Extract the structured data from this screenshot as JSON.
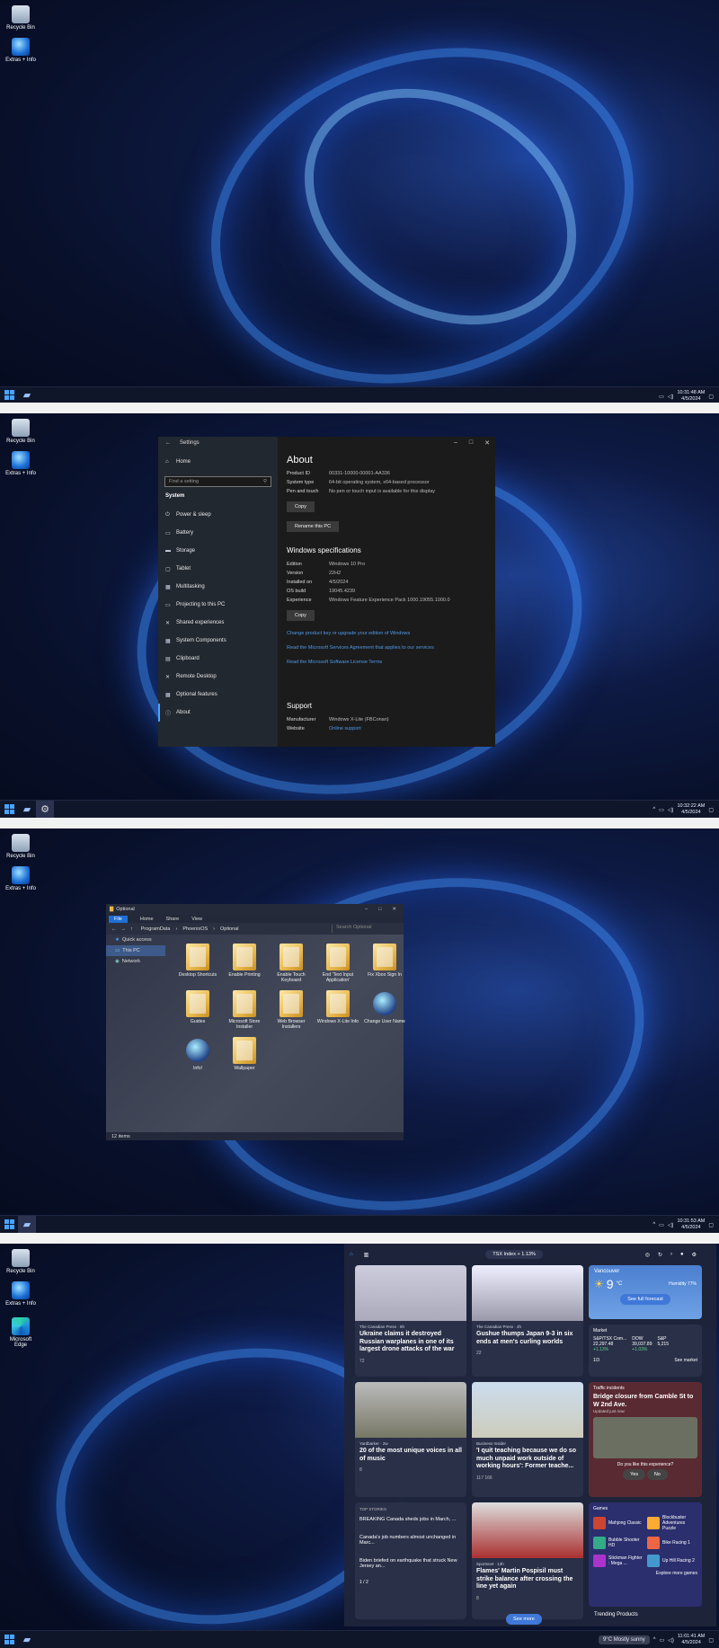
{
  "colors": {
    "accent": "#4aa3ff",
    "link": "#4f9ae8",
    "file_tab": "#1f6ed6"
  },
  "desktop": {
    "recycle": "Recycle Bin",
    "extras": "Extras + Info",
    "edge": "Microsoft Edge"
  },
  "clocks": [
    {
      "time": "10:31:48 AM",
      "date": "4/5/2024"
    },
    {
      "time": "10:32:22 AM",
      "date": "4/5/2024"
    },
    {
      "time": "10:31:53 AM",
      "date": "4/5/2024"
    },
    {
      "time": "11:01:41 AM",
      "date": "4/5/2024"
    }
  ],
  "settings": {
    "title": "Settings",
    "home": "Home",
    "search_placeholder": "Find a setting",
    "section": "System",
    "nav": [
      "Power & sleep",
      "Battery",
      "Storage",
      "Tablet",
      "Multitasking",
      "Projecting to this PC",
      "Shared experiences",
      "System Components",
      "Clipboard",
      "Remote Desktop",
      "Optional features",
      "About"
    ],
    "nav_icons": [
      "⏻",
      "▭",
      "▬",
      "▢",
      "▦",
      "▭",
      "✕",
      "▦",
      "▤",
      "✕",
      "▦",
      "ⓘ"
    ],
    "about": "About",
    "device_rows": [
      {
        "k": "Product ID",
        "v": "00331-10000-00001-AA336"
      },
      {
        "k": "System type",
        "v": "64-bit operating system, x64-based processor"
      },
      {
        "k": "Pen and touch",
        "v": "No pen or touch input is available for this display"
      }
    ],
    "copy": "Copy",
    "rename": "Rename this PC",
    "winspec_title": "Windows specifications",
    "spec_rows": [
      {
        "k": "Edition",
        "v": "Windows 10 Pro"
      },
      {
        "k": "Version",
        "v": "22H2"
      },
      {
        "k": "Installed on",
        "v": "4/5/2024"
      },
      {
        "k": "OS build",
        "v": "19045.4239"
      },
      {
        "k": "Experience",
        "v": "Windows Feature Experience Pack 1000.19055.1000.0"
      }
    ],
    "links": [
      "Change product key or upgrade your edition of Windows",
      "Read the Microsoft Services Agreement that applies to our services",
      "Read the Microsoft Software License Terms"
    ],
    "support_title": "Support",
    "support_rows": [
      {
        "k": "Manufacturer",
        "v": "Windows X-Lite (FBConan)"
      },
      {
        "k": "Website",
        "v": "Online support"
      }
    ]
  },
  "explorer": {
    "title": "Optional",
    "tabs": [
      "File",
      "Home",
      "Share",
      "View"
    ],
    "path": [
      "ProgramData",
      "PhoenixOS",
      "Optional"
    ],
    "search": "Search Optional",
    "nav": [
      "Quick access",
      "This PC",
      "Network"
    ],
    "items": [
      {
        "label": "Desktop Shortcuts",
        "kind": "folder"
      },
      {
        "label": "Enable Printing",
        "kind": "folder"
      },
      {
        "label": "Enable Touch Keyboard",
        "kind": "folder"
      },
      {
        "label": "End 'Text Input Application'",
        "kind": "folder"
      },
      {
        "label": "Fix Xbox Sign In",
        "kind": "folder"
      },
      {
        "label": "Guides",
        "kind": "folder"
      },
      {
        "label": "Microsoft Store Installer",
        "kind": "folder"
      },
      {
        "label": "Web Browser Installers",
        "kind": "folder"
      },
      {
        "label": "Windows X-Lite Info",
        "kind": "folder"
      },
      {
        "label": "Change User Name",
        "kind": "orb"
      },
      {
        "label": "Info!",
        "kind": "orb"
      },
      {
        "label": "Wallpaper",
        "kind": "folder"
      }
    ],
    "status": "12 items"
  },
  "widgets": {
    "ticker": "TSX Index + 1.13%",
    "cards": [
      {
        "src": "The Canadian Press · 8h",
        "hd": "Ukraine claims it destroyed Russian warplanes in one of its largest drone attacks of the war",
        "meta": "72"
      },
      {
        "src": "The Canadian Press · 2h",
        "hd": "Gushue thumps Japan 9-3 in six ends at men's curling worlds",
        "meta": "22"
      },
      {
        "src": "Yardbarker · 2w",
        "hd": "20 of the most unique voices in all of music",
        "meta": "8"
      },
      {
        "src": "Business Insider",
        "hd": "'I quit teaching because we do so much unpaid work outside of working hours': Former teache...",
        "meta": "117  166"
      },
      {
        "src": "Sportsnet · 13h",
        "hd": "Flames' Martin Pospisil must strike balance after crossing the line yet again",
        "meta": "8"
      }
    ],
    "weather": {
      "city": "Vancouver",
      "temp": "9",
      "unit": "°C",
      "humidity": "Humidity 77%",
      "forecast": "See full forecast"
    },
    "market": {
      "title": "Market",
      "items": [
        {
          "n": "S&P/TSX Com...",
          "v": "22,297.48",
          "c": "+1.13%"
        },
        {
          "n": "DOW",
          "v": "39,037.89",
          "c": "+1.03%"
        },
        {
          "n": "S&P",
          "v": "5,215"
        }
      ],
      "page": "1/3",
      "see": "See market"
    },
    "traffic": {
      "title": "Traffic incidents",
      "hd": "Bridge closure from Camble St to W 2nd Ave.",
      "sub": "Updated just now",
      "ask": "Do you like this experience?",
      "yes": "Yes",
      "no": "No"
    },
    "top": {
      "label": "TOP STORIES",
      "items": [
        "BREAKING Canada sheds jobs in March, ...",
        "Canada's job numbers almost unchanged in Marc...",
        "Biden briefed on earthquake that struck New Jersey an..."
      ],
      "page": "1 / 2"
    },
    "games": {
      "title": "Games",
      "items": [
        "Mahjong Classic",
        "Blockbuster Adventures Puzzle",
        "Bubble Shooter HD",
        "Bike Racing 1",
        "Stickman Fighter : Mega ...",
        "Up Hill Racing 2"
      ],
      "more": "Explore more games"
    },
    "trending": "Trending Products",
    "seemore": "See more",
    "weather_tb": "9°C  Mostly sunny"
  }
}
